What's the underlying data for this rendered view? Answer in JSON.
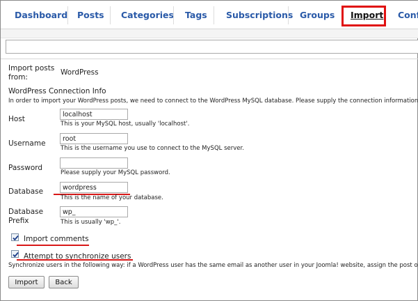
{
  "tabs": [
    {
      "label": "Dashboard"
    },
    {
      "label": "Posts"
    },
    {
      "label": "Categories"
    },
    {
      "label": "Tags"
    },
    {
      "label": "Subscriptions"
    },
    {
      "label": "Groups"
    },
    {
      "label": "Import"
    },
    {
      "label": "Confi"
    }
  ],
  "filter": {
    "value": ""
  },
  "import_from": {
    "label": "Import posts from:",
    "label_line1": "Import posts",
    "label_line2": "from:",
    "value": "WordPress"
  },
  "connection": {
    "heading": "WordPress Connection Info",
    "intro": "In order to import your WordPress posts, we need to connect to the WordPress MySQL database. Please supply the connection information"
  },
  "fields": {
    "host": {
      "label": "Host",
      "value": "localhost",
      "hint": "This is your MySQL host, usually 'localhost'."
    },
    "username": {
      "label": "Username",
      "value": "root",
      "hint": "This is the username you use to connect to the MySQL server."
    },
    "password": {
      "label": "Password",
      "value": "",
      "hint": "Please supply your MySQL password."
    },
    "database": {
      "label": "Database",
      "value": "wordpress",
      "hint": "This is the name of your database."
    },
    "prefix": {
      "label": "Database Prefix",
      "label_line1": "Database",
      "label_line2": "Prefix",
      "value": "wp_",
      "hint": "This is usually 'wp_'."
    }
  },
  "options": {
    "import_comments": {
      "label": "Import comments",
      "checked": true
    },
    "sync_users": {
      "label": "Attempt to synchronize users",
      "checked": true,
      "description": "Synchronize users in the following way: if a WordPress user has the same email as another user in your Joomla! website, assign the post or"
    }
  },
  "buttons": {
    "import": "Import",
    "back": "Back"
  },
  "colors": {
    "link": "#2a5aa8",
    "annotation": "#e01010"
  }
}
